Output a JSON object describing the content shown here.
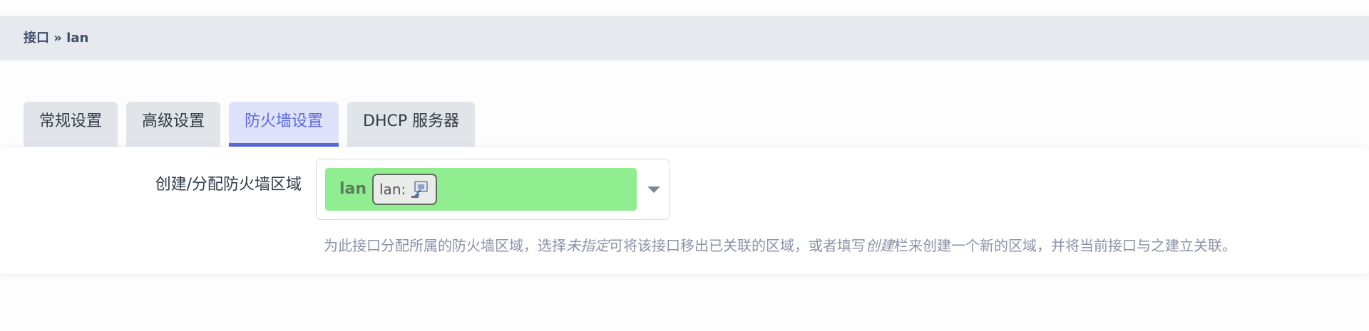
{
  "breadcrumb": {
    "text": "接口 » lan"
  },
  "tabs": [
    {
      "label": "常规设置",
      "active": false
    },
    {
      "label": "高级设置",
      "active": false
    },
    {
      "label": "防火墙设置",
      "active": true
    },
    {
      "label": "DHCP 服务器",
      "active": false
    }
  ],
  "firewall": {
    "field_label": "创建/分配防火墙区域",
    "selected_zone": "lan",
    "zone_color": "#90ee90",
    "interface_badge": "lan:",
    "interface_icon": "ethernet-port-icon",
    "help": {
      "part1": "为此接口分配所属的防火墙区域，选择",
      "em1": "未指定",
      "part2": "可将该接口移出已关联的区域，或者填写",
      "em2": "创建",
      "part3": "栏来创建一个新的区域，并将当前接口与之建立关联。"
    }
  },
  "colors": {
    "accent": "#5a67d8",
    "breadcrumb_bg": "#e6eaee"
  }
}
